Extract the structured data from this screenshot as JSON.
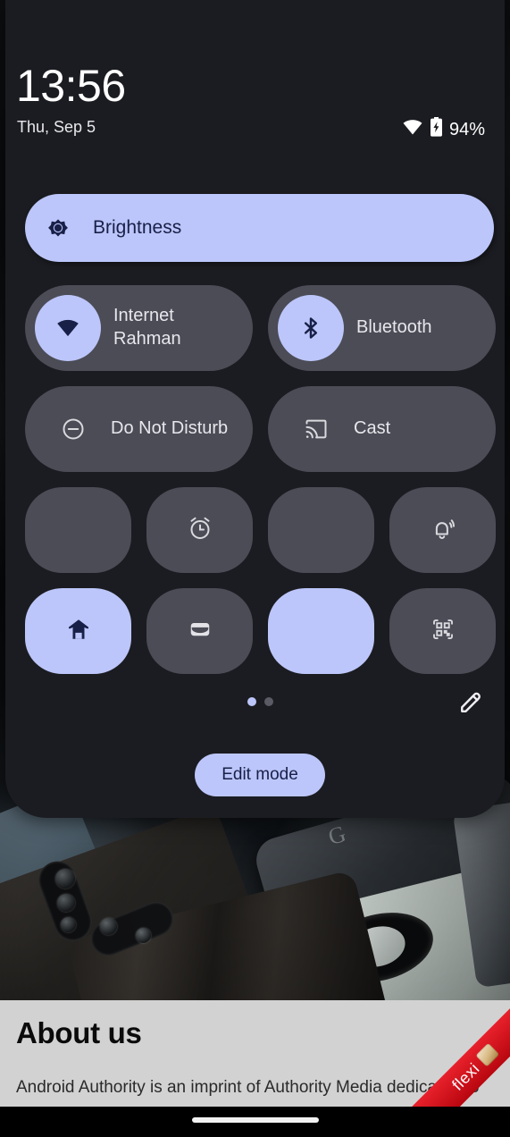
{
  "status_bar": {
    "time": "13:56",
    "date": "Thu, Sep 5",
    "battery_percent": "94%",
    "wifi_icon": "wifi-icon",
    "battery_icon": "battery-charging-icon"
  },
  "brightness": {
    "label": "Brightness",
    "icon": "brightness-sun-icon",
    "active_color": "#bcc6fa",
    "level_percent": 100
  },
  "tiles": {
    "wide": [
      {
        "name": "internet",
        "title": "Internet",
        "subtitle": "Rahman",
        "icon": "wifi-icon",
        "active": true
      },
      {
        "name": "bluetooth",
        "title": "Bluetooth",
        "subtitle": "",
        "icon": "bluetooth-icon",
        "active": true
      },
      {
        "name": "do-not-disturb",
        "title": "Do Not Disturb",
        "subtitle": "",
        "icon": "do-not-disturb-icon",
        "active": false
      },
      {
        "name": "cast",
        "title": "Cast",
        "subtitle": "",
        "icon": "cast-icon",
        "active": false
      }
    ],
    "small": [
      {
        "name": "tile-blank-1",
        "icon": "",
        "active": false
      },
      {
        "name": "alarm",
        "icon": "alarm-clock-icon",
        "active": false
      },
      {
        "name": "tile-blank-2",
        "icon": "",
        "active": false
      },
      {
        "name": "ring-mode",
        "icon": "bell-ringing-icon",
        "active": false
      },
      {
        "name": "home",
        "icon": "home-icon",
        "active": true
      },
      {
        "name": "wallet",
        "icon": "wallet-icon",
        "active": false
      },
      {
        "name": "tile-blank-3",
        "icon": "",
        "active": true
      },
      {
        "name": "qr-scanner",
        "icon": "qr-code-icon",
        "active": false
      }
    ]
  },
  "pagination": {
    "pages": 2,
    "current": 1
  },
  "edit": {
    "pencil_icon": "pencil-icon",
    "edit_mode_label": "Edit mode"
  },
  "about": {
    "title": "About us",
    "body": "Android Authority is an imprint of Authority Media dedicated to"
  },
  "ribbon": {
    "text": "flexi",
    "color": "#d4101a"
  },
  "nav": {
    "home_indicator": "home-indicator"
  },
  "theme": {
    "panel_bg": "#1b1c21",
    "tile_inactive": "#4b4c56",
    "tile_active": "#bcc6fa",
    "accent_text_dark": "#182047"
  }
}
